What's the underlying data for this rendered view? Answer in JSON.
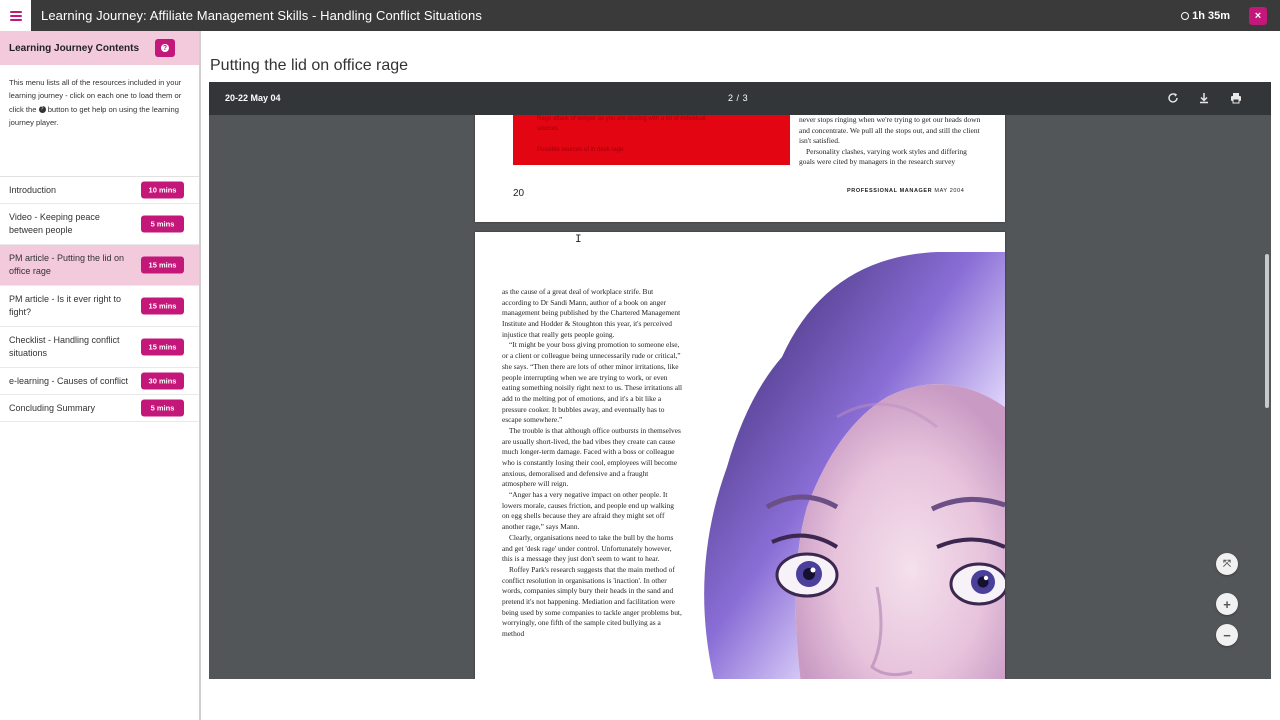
{
  "header": {
    "title": "Learning Journey: Affiliate Management Skills - Handling Conflict Situations",
    "timer": "1h 35m",
    "close_label": "×"
  },
  "sidebar": {
    "title": "Learning Journey Contents",
    "desc_part1": "This menu lists all of the resources included in your learning journey - click on each one to load them or click the",
    "desc_part2": "button to get help on using the learning journey player.",
    "items": [
      {
        "label": "Introduction",
        "duration": "10 mins"
      },
      {
        "label": "Video - Keeping peace between people",
        "duration": "5 mins"
      },
      {
        "label": "PM article - Putting the lid on office rage",
        "duration": "15 mins"
      },
      {
        "label": "PM article - Is it ever right to fight?",
        "duration": "15 mins"
      },
      {
        "label": "Checklist - Handling conflict situations",
        "duration": "15 mins"
      },
      {
        "label": "e-learning - Causes of conflict",
        "duration": "30 mins"
      },
      {
        "label": "Concluding Summary",
        "duration": "5 mins"
      }
    ]
  },
  "main": {
    "title": "Putting the lid on office rage"
  },
  "viewer": {
    "doc_name": "20-22 May 04",
    "page_current": "2",
    "page_sep": "/",
    "page_total": "3",
    "page1": {
      "red_line1": "Rage attack of temper as you are dealing with a lot of individual",
      "red_line2": "sources",
      "red_line3": "Possible sources of in desk rage",
      "right_text": "never stops ringing when we're trying to get our heads down and concentrate. We pull all the stops out, and still the client isn't satisfied.",
      "right_text2": "Personality clashes, varying work styles and differing goals were cited by managers in the research survey",
      "page_number": "20",
      "footer_brand": "PROFESSIONAL MANAGER",
      "footer_date": "MAY 2004"
    },
    "page2": {
      "paragraphs": [
        "as the cause of a great deal of workplace strife. But according to Dr Sandi Mann, author of a book on anger management being published by the Chartered Management Institute and Hodder & Stoughton this year, it's perceived injustice that really gets people going.",
        "“It might be your boss giving promotion to someone else, or a client or colleague being unnecessarily rude or critical,” she says. “Then there are lots of other minor irritations, like people interrupting when we are trying to work, or even eating something noisily right next to us. These irritations all add to the melting pot of emotions, and it's a bit like a pressure cooker. It bubbles away, and eventually has to escape somewhere.”",
        "The trouble is that although office outbursts in themselves are usually short-lived, the bad vibes they create can cause much longer-term damage. Faced with a boss or colleague who is constantly losing their cool, employees will become anxious, demoralised and defensive and a fraught atmosphere will reign.",
        "“Anger has a very negative impact on other people. It lowers morale, causes friction, and people end up walking on egg shells because they are afraid they might set off another rage,” says Mann.",
        "Clearly, organisations need to take the bull by the horns and get 'desk rage' under control. Unfortunately however, this is a message they just don't seem to want to hear.",
        "Roffey Park's research suggests that the main method of conflict resolution in organisations is 'inaction'. In other words, companies simply bury their heads in the sand and pretend it's not happening. Mediation and facilitation were being used by some companies to tackle anger problems but, worryingly, one fifth of the sample cited bullying as a method"
      ]
    },
    "controls": {
      "fit_label": "⤧",
      "zoom_in_label": "+",
      "zoom_out_label": "−"
    }
  },
  "colors": {
    "accent": "#c4177a",
    "accent_light": "#f3c9dc",
    "topbar": "#3a3a3a",
    "viewer_bg": "#525659",
    "viewer_bar": "#323639"
  }
}
